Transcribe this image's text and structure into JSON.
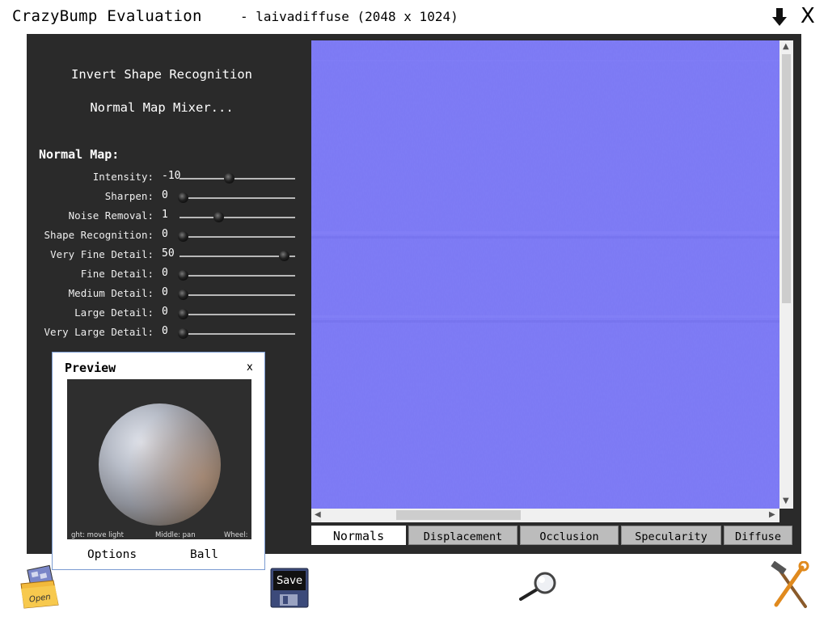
{
  "window": {
    "title": "CrazyBump Evaluation",
    "subtitle": "- laivadiffuse (2048 x 1024)"
  },
  "menu": {
    "invert": "Invert Shape Recognition",
    "mixer": "Normal Map Mixer..."
  },
  "normal_map": {
    "heading": "Normal Map:",
    "sliders": [
      {
        "label": "Intensity:",
        "value": "-10",
        "level": 0.44
      },
      {
        "label": "Sharpen:",
        "value": "0",
        "level": 0.0
      },
      {
        "label": "Noise Removal:",
        "value": "1",
        "level": 0.34
      },
      {
        "label": "Shape Recognition:",
        "value": "0",
        "level": 0.0
      },
      {
        "label": "Very Fine Detail:",
        "value": "50",
        "level": 0.96
      },
      {
        "label": "Fine Detail:",
        "value": "0",
        "level": 0.0
      },
      {
        "label": "Medium Detail:",
        "value": "0",
        "level": 0.0
      },
      {
        "label": "Large Detail:",
        "value": "0",
        "level": 0.0
      },
      {
        "label": "Very Large Detail:",
        "value": "0",
        "level": 0.0
      }
    ]
  },
  "preview": {
    "title": "Preview",
    "close": "x",
    "hint_left": "ght: move light",
    "hint_middle": "Middle: pan",
    "hint_right": "Wheel:",
    "options_label": "Options",
    "ball_label": "Ball"
  },
  "tabs": [
    {
      "label": "Normals",
      "active": true
    },
    {
      "label": "Displacement",
      "active": false
    },
    {
      "label": "Occlusion",
      "active": false
    },
    {
      "label": "Specularity",
      "active": false
    },
    {
      "label": "Diffuse",
      "active": false
    }
  ],
  "toolbar": {
    "open_label": "Open",
    "save_label": "Save"
  },
  "icons": {
    "download": "down-arrow-icon",
    "close": "X",
    "zoom": "magnifier-icon",
    "tools": "hammer-wrench-icon"
  },
  "colors": {
    "normal_map": "#7b78f4",
    "panel": "#2a2a2a"
  }
}
